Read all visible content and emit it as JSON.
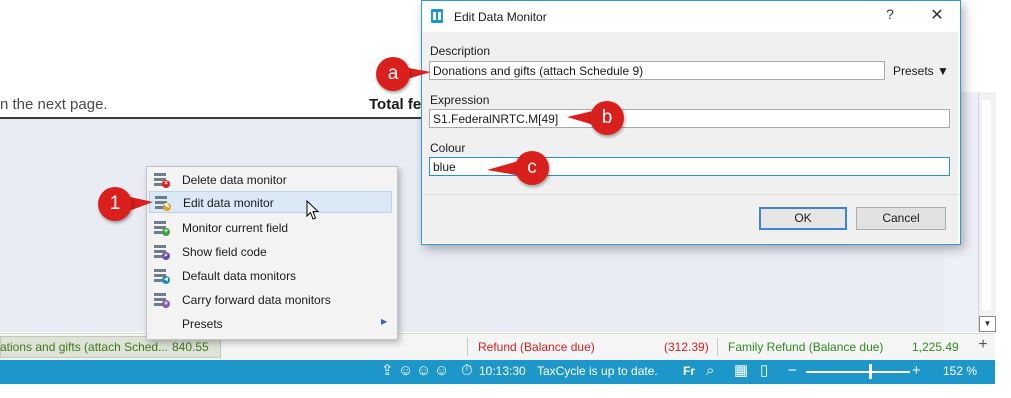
{
  "background_doc": {
    "left_text": "n the next page.",
    "right_text": "Total fe"
  },
  "monitor_bar": {
    "chip_label": "ations and gifts (attach Sched...",
    "chip_value": "840.55",
    "refund_label": "Refund (Balance due)",
    "refund_value": "(312.39)",
    "family_label": "Family Refund (Balance due)",
    "family_value": "1,225.49",
    "add_icon": "plus-icon"
  },
  "status_bar": {
    "time": "10:13:30",
    "status_text": "TaxCycle is up to date.",
    "lang": "Fr",
    "zoom": "152 %",
    "zoom_level_fraction": 0.62
  },
  "context_menu": {
    "items": [
      {
        "label": "Delete data monitor",
        "icon": "delete-monitor-icon",
        "badge_color": "#d9201c"
      },
      {
        "label": "Edit data monitor",
        "icon": "edit-monitor-icon",
        "badge_color": "#e0a020"
      },
      {
        "label": "Monitor current field",
        "icon": "add-monitor-icon",
        "badge_color": "#3aa33a"
      },
      {
        "label": "Show field code",
        "icon": "field-code-icon",
        "badge_color": "#6a4bb0"
      },
      {
        "label": "Default data monitors",
        "icon": "default-monitors-icon",
        "badge_color": "#1f8ac0"
      },
      {
        "label": "Carry forward data monitors",
        "icon": "carry-forward-icon",
        "badge_color": "#8a5bb0"
      },
      {
        "label": "Presets",
        "icon": "",
        "badge_color": ""
      }
    ],
    "highlighted_index": 1
  },
  "dialog": {
    "title": "Edit Data Monitor",
    "help": "?",
    "close": "✕",
    "description_label": "Description",
    "description_value": "Donations and gifts (attach Schedule 9)",
    "presets_label": "Presets ▼",
    "expression_label": "Expression",
    "expression_value": "S1.FederalNRTC.M[49]",
    "colour_label": "Colour",
    "colour_value": "blue",
    "ok_label": "OK",
    "cancel_label": "Cancel"
  },
  "callouts": {
    "a": "a",
    "b": "b",
    "c": "c",
    "one": "1"
  },
  "colors": {
    "accent": "#1d96c9",
    "callout": "#d9201c",
    "refund": "#d42020",
    "positive": "#2f8a1e"
  }
}
